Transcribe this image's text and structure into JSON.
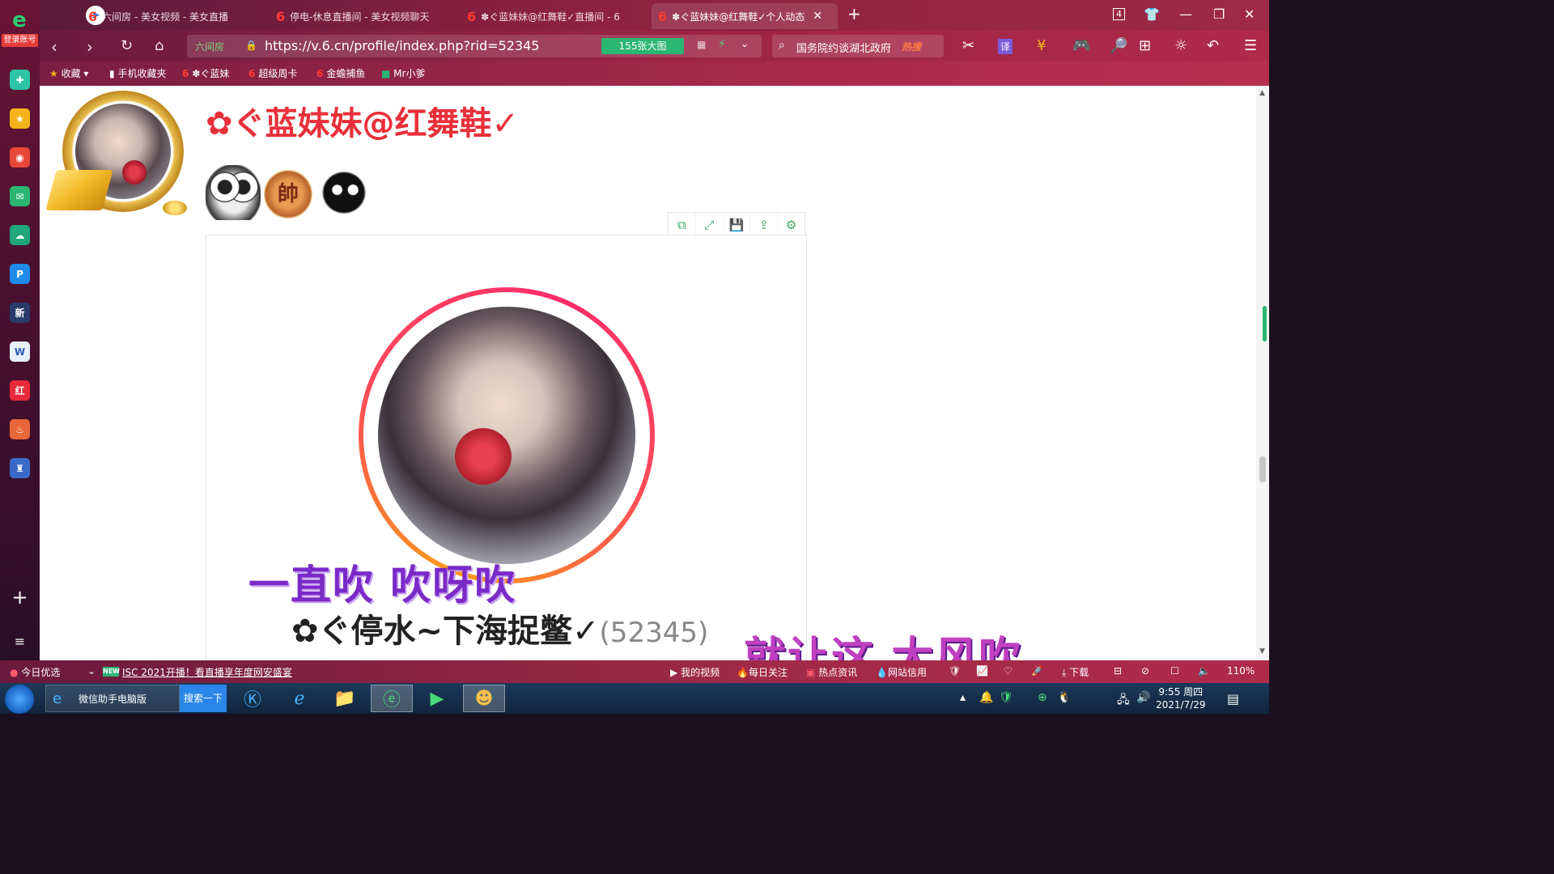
{
  "sidebar": {
    "login_label": "登录账号",
    "apps": [
      {
        "name": "plus-app",
        "glyph": "✚",
        "color": "#2ec4a6"
      },
      {
        "name": "star-app",
        "glyph": "★",
        "color": "#f5b31b"
      },
      {
        "name": "weibo-app",
        "glyph": "◉",
        "color": "#e8473a"
      },
      {
        "name": "mail-app",
        "glyph": "✉",
        "color": "#2bb673"
      },
      {
        "name": "cloud-app",
        "glyph": "☁",
        "color": "#1fa67a"
      },
      {
        "name": "p-app",
        "glyph": "P",
        "color": "#1f8ae8"
      },
      {
        "name": "news-app",
        "glyph": "新",
        "color": "#2a3a6a"
      },
      {
        "name": "word-app",
        "glyph": "W",
        "color": "#e8f0fa"
      },
      {
        "name": "xiaohongshu-app",
        "glyph": "红",
        "color": "#e82a3a"
      },
      {
        "name": "game-app",
        "glyph": "♨",
        "color": "#e8663a"
      },
      {
        "name": "castle-app",
        "glyph": "♜",
        "color": "#3a6ac8"
      }
    ],
    "add_label": "+",
    "menu_label": "≡"
  },
  "tabs": [
    {
      "title": "六间房 - 美女视频 - 美女直播",
      "active": false
    },
    {
      "title": "停电-休息直播间 - 美女视频聊天",
      "active": false
    },
    {
      "title": "✽ぐ蓝妹妹@红舞鞋✓直播间 - 6",
      "active": false
    },
    {
      "title": "✽ぐ蓝妹妹@红舞鞋✓个人动态",
      "active": true
    }
  ],
  "tab_count": "4",
  "addr": {
    "cert_label": "六间房",
    "url": "https://v.6.cn/profile/index.php?rid=52345",
    "bigpic_label": "155张大图",
    "search_text": "国务院约谈湖北政府",
    "search_hot": "热搜",
    "zoom": "110%"
  },
  "favorites": [
    {
      "label": "收藏",
      "icon": "star"
    },
    {
      "label": "手机收藏夹",
      "icon": "phone"
    },
    {
      "label": "✽ぐ蓝妹",
      "icon": "six"
    },
    {
      "label": "超级周卡",
      "icon": "six"
    },
    {
      "label": "金蟾捕鱼",
      "icon": "six"
    },
    {
      "label": "Mr小爹",
      "icon": "green"
    }
  ],
  "profile": {
    "nickname": "✿ぐ蓝妹妹@红舞鞋✓",
    "coin_badge": "帥",
    "captions": {
      "line1": "一直吹  吹呀吹",
      "line2_name": "✿ぐ停水~下海捉鳖✓",
      "line2_rid": "(52345)",
      "line3": "就让这  大风吹"
    }
  },
  "post_toolbar": {
    "buttons": [
      "copy-icon",
      "fullscreen-icon",
      "save-icon",
      "share-icon",
      "settings-icon"
    ]
  },
  "statusbar": {
    "left_label": "今日优选",
    "new_badge": "NEW",
    "headline": "ISC 2021开播！看直播享年度网安盛宴",
    "items": [
      "我的视频",
      "每日关注",
      "热点资讯",
      "网站信用"
    ],
    "download_label": "下载",
    "zoom": "110%"
  },
  "taskbar": {
    "task_label": "微信助手电脑版",
    "search_label": "搜索一下",
    "time": "9:55 周四",
    "date": "2021/7/29"
  }
}
